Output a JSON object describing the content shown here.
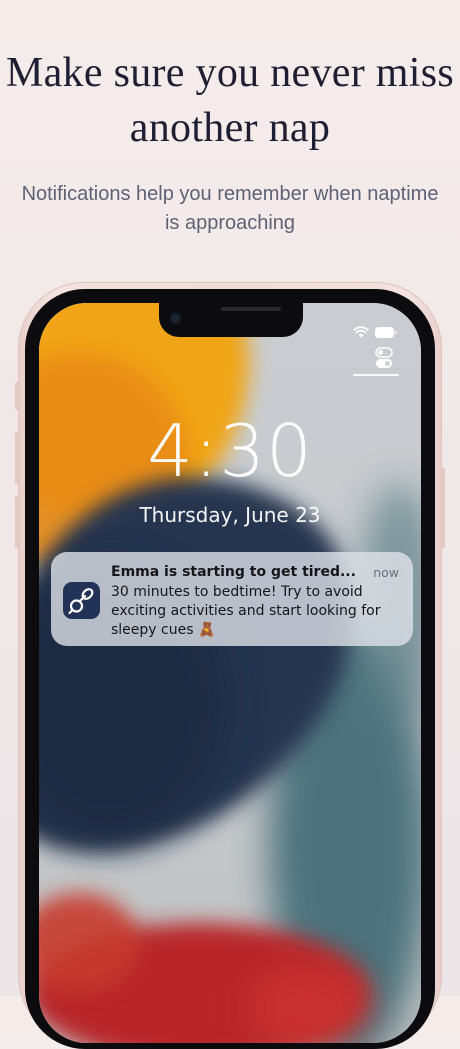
{
  "headline": "Make sure you never miss another nap",
  "subhead": "Notifications help you remember when naptime is approaching",
  "lockscreen": {
    "time": "4:30",
    "date": "Thursday, June 23"
  },
  "notification": {
    "app_icon": "pacifier-icon",
    "title": "Emma is starting to get tired...",
    "time": "now",
    "body": "30 minutes to bedtime! Try to avoid exciting activities and start looking for sleepy cues 🧸"
  },
  "status_bar": {
    "icons": [
      "wifi-icon",
      "battery-icon"
    ]
  },
  "colors": {
    "background": "#f2eae8",
    "headline": "#1f1f33",
    "subhead": "#5d6277",
    "app_icon_bg": "#233257",
    "phone_frame": "#f1ddd8"
  }
}
